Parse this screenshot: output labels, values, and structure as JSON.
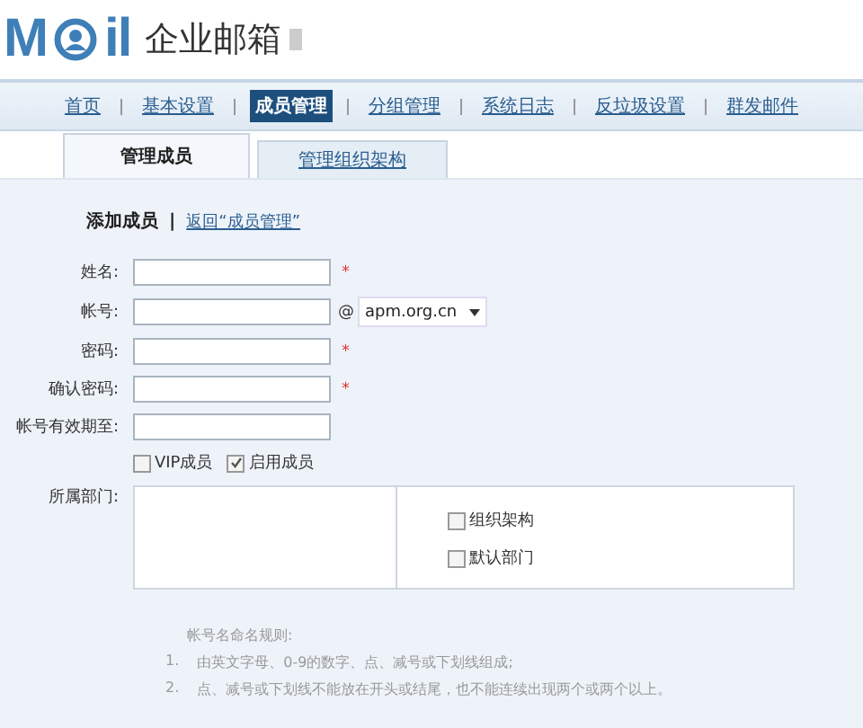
{
  "logo": {
    "letters_before": "M",
    "letters_after": "il",
    "product": "企业邮箱"
  },
  "nav": [
    {
      "label": "首页",
      "selected": false
    },
    {
      "label": "基本设置",
      "selected": false
    },
    {
      "label": "成员管理",
      "selected": true
    },
    {
      "label": "分组管理",
      "selected": false
    },
    {
      "label": "系统日志",
      "selected": false
    },
    {
      "label": "反垃圾设置",
      "selected": false
    },
    {
      "label": "群发邮件",
      "selected": false
    }
  ],
  "tabs": [
    {
      "label": "管理成员",
      "selected": true
    },
    {
      "label": "管理组织架构",
      "selected": false
    }
  ],
  "heading": {
    "title": "添加成员",
    "separator": "|",
    "back_link": "返回“成员管理”"
  },
  "fields": [
    {
      "label": "姓名:",
      "required_mark": "*",
      "kind": "text"
    },
    {
      "label": "帐号:",
      "kind": "account",
      "at": "@",
      "domain": "apm.org.cn"
    },
    {
      "label": "密码:",
      "required_mark": "*",
      "kind": "text"
    },
    {
      "label": "确认密码:",
      "required_mark": "*",
      "kind": "text"
    },
    {
      "label": "帐号有效期至:",
      "kind": "text"
    }
  ],
  "options": [
    {
      "label": "VIP成员",
      "checked": false
    },
    {
      "label": "启用成员",
      "checked": true
    }
  ],
  "department": {
    "label": "所属部门:",
    "items": [
      {
        "label": "组织架构",
        "checked": false
      },
      {
        "label": "默认部门",
        "checked": false
      }
    ]
  },
  "rules": {
    "title": "帐号名命名规则:",
    "items": [
      {
        "number": "1.",
        "text": "由英文字母、0-9的数字、点、减号或下划线组成;"
      },
      {
        "number": "2.",
        "text": "点、减号或下划线不能放在开头或结尾，也不能连续出现两个或两个以上。"
      }
    ]
  }
}
